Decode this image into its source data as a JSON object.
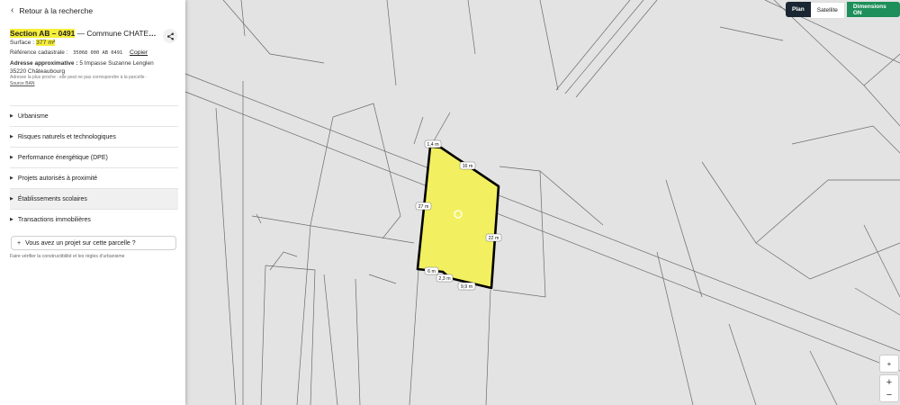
{
  "panel": {
    "back_label": "Retour à la recherche",
    "title_section": "Section AB – 0491",
    "title_rest": " — Commune CHATEAUBOURG",
    "surface_label": "Surface : ",
    "surface_value": "377 m²",
    "ref_label": "Référence cadastrale :",
    "ref_code": "35068 000 AB 0491",
    "copy_label": "Copier",
    "addr_label": "Adresse approximative : ",
    "addr_line1": "5 Impasse Suzanne Lenglen",
    "addr_line2": "35220 Châteaubourg",
    "addr_note": "Adresse la plus proche : elle peut ne pas correspondre à la parcelle ·",
    "addr_source": "Source BAN",
    "sections": [
      {
        "label": "Urbanisme"
      },
      {
        "label": "Risques naturels et technologiques"
      },
      {
        "label": "Performance énergétique (DPE)"
      },
      {
        "label": "Projets autorisés à proximité"
      },
      {
        "label": "Établissements scolaires"
      },
      {
        "label": "Transactions immobilières"
      }
    ],
    "project_label": "Vous avez un projet sur cette parcelle ?",
    "project_note": "Faire vérifier la constructibilité et les règles d'urbanisme"
  },
  "map_controls": {
    "plan": "Plan",
    "satellite": "Satellite",
    "dimensions": "Dimensions ON",
    "compass": "+",
    "zoom_in": "+",
    "zoom_out": "−"
  },
  "dimensions": {
    "top": "1,4 m",
    "upper_right": "16 m",
    "left": "27 m",
    "right": "22 m",
    "bottom_left": "6 m",
    "bottom_step": "2,3 m",
    "bottom": "9,9 m"
  },
  "colors": {
    "parcel_fill": "#f2f060",
    "highlight": "#f5ee3a",
    "plan_button": "#1a2733",
    "dimensions_button": "#1e8f5a"
  }
}
